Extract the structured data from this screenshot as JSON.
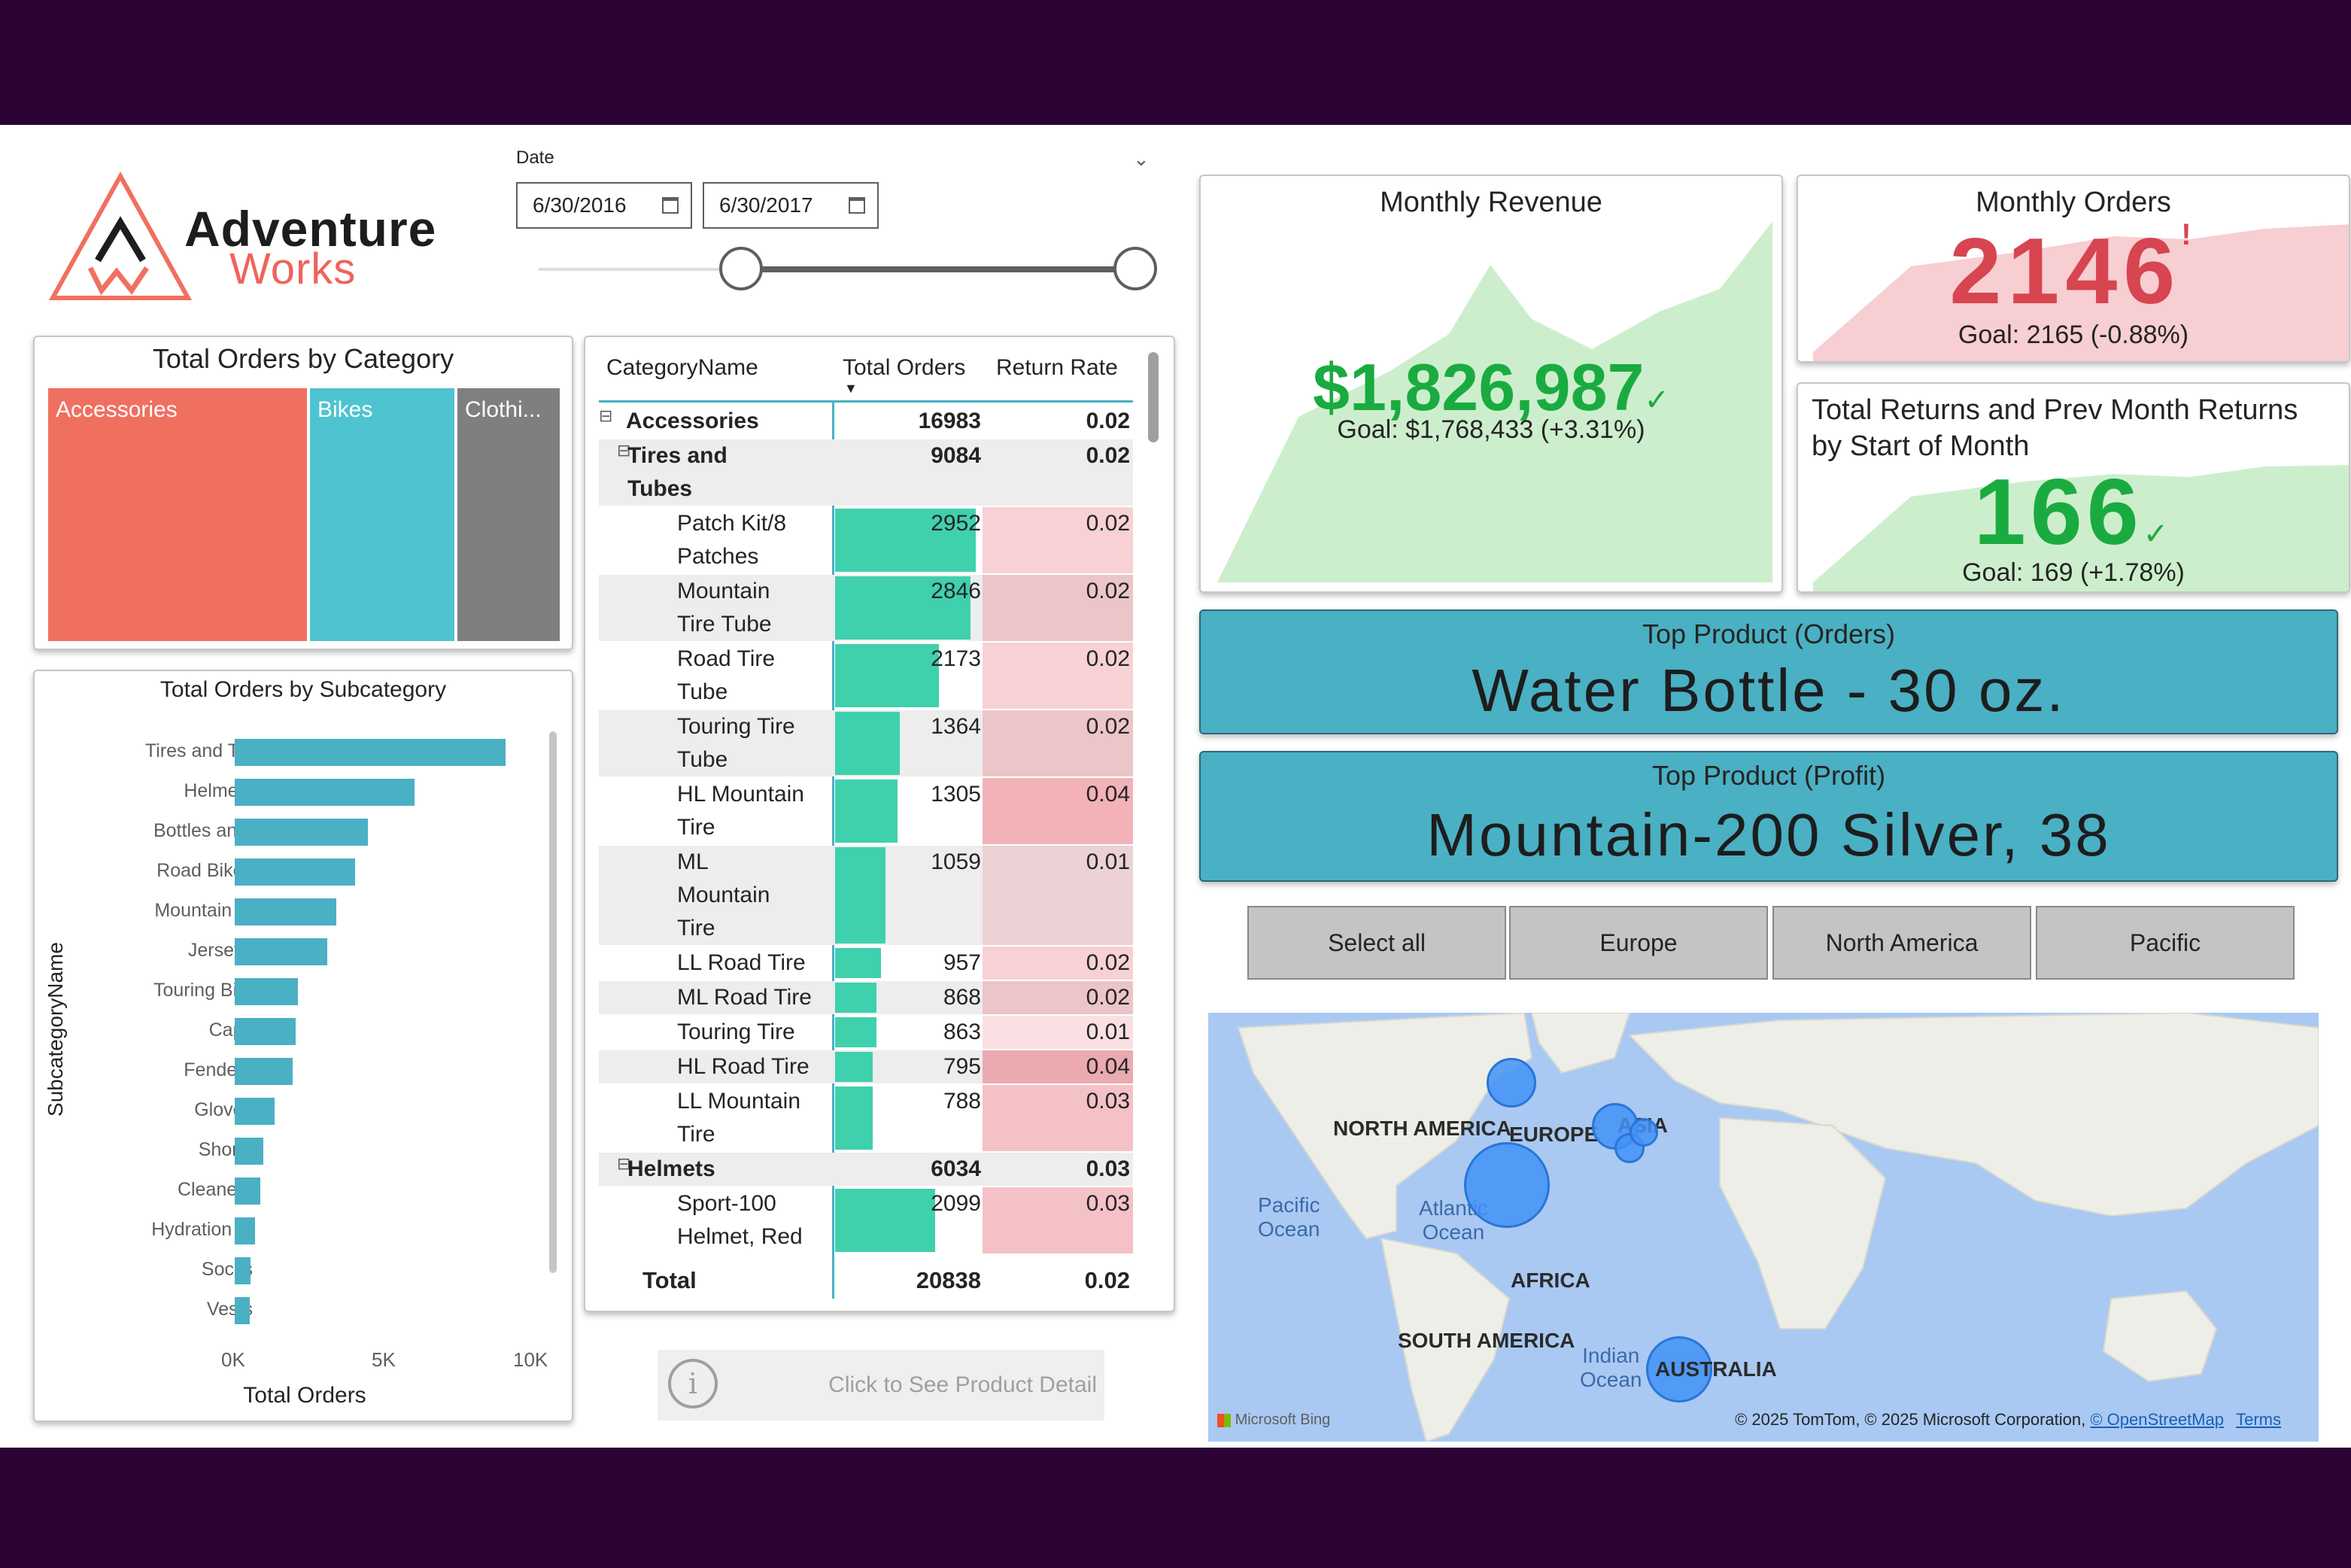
{
  "logo": {
    "brand_top": "Adventure",
    "brand_bottom": "Works"
  },
  "date_slicer": {
    "label": "Date",
    "start": "6/30/2016",
    "end": "6/30/2017"
  },
  "treemap": {
    "title": "Total Orders by Category",
    "cells": [
      {
        "label": "Accessories",
        "color": "#f0705f"
      },
      {
        "label": "Bikes",
        "color": "#4ec4d0"
      },
      {
        "label": "Clothi...",
        "color": "#7f7f7f"
      }
    ]
  },
  "subcategory_chart": {
    "title": "Total Orders by Subcategory",
    "ylabel": "SubcategoryName",
    "xlabel": "Total Orders",
    "ticks": [
      "0K",
      "5K",
      "10K"
    ]
  },
  "chart_data": {
    "type": "bar",
    "title": "Total Orders by Subcategory",
    "xlabel": "Total Orders",
    "ylabel": "SubcategoryName",
    "xlim": [
      0,
      10000
    ],
    "categories": [
      "Tires and T...",
      "Helmets",
      "Bottles an...",
      "Road Bikes",
      "Mountain ...",
      "Jerseys",
      "Touring Bi...",
      "Caps",
      "Fenders",
      "Gloves",
      "Shorts",
      "Cleaners",
      "Hydration ...",
      "Socks",
      "Vests"
    ],
    "values": [
      9084,
      6034,
      4470,
      4050,
      3420,
      3100,
      2120,
      2050,
      1950,
      1330,
      950,
      850,
      690,
      520,
      500
    ]
  },
  "matrix": {
    "headers": {
      "name": "CategoryName",
      "orders": "Total Orders",
      "return": "Return Rate"
    },
    "max_orders": 3000,
    "rows": [
      {
        "level": 0,
        "lines": [
          "Accessories"
        ],
        "orders": "16983",
        "rate": "0.02",
        "bold": true,
        "expander": "⊟"
      },
      {
        "level": 1,
        "lines": [
          "Tires and",
          "Tubes"
        ],
        "orders": "9084",
        "rate": "0.02",
        "bold": true,
        "expander": "⊟"
      },
      {
        "level": 2,
        "lines": [
          "Patch Kit/8",
          "Patches"
        ],
        "orders": "2952",
        "rate": "0.02",
        "n": 2952,
        "r": 0.02
      },
      {
        "level": 2,
        "lines": [
          "Mountain",
          "Tire Tube"
        ],
        "orders": "2846",
        "rate": "0.02",
        "n": 2846,
        "r": 0.02
      },
      {
        "level": 2,
        "lines": [
          "Road Tire",
          "Tube"
        ],
        "orders": "2173",
        "rate": "0.02",
        "n": 2173,
        "r": 0.02
      },
      {
        "level": 2,
        "lines": [
          "Touring Tire",
          "Tube"
        ],
        "orders": "1364",
        "rate": "0.02",
        "n": 1364,
        "r": 0.02
      },
      {
        "level": 2,
        "lines": [
          "HL Mountain",
          "Tire"
        ],
        "orders": "1305",
        "rate": "0.04",
        "n": 1305,
        "r": 0.04
      },
      {
        "level": 2,
        "lines": [
          "ML",
          "Mountain",
          "Tire"
        ],
        "orders": "1059",
        "rate": "0.01",
        "n": 1059,
        "r": 0.01
      },
      {
        "level": 2,
        "lines": [
          "LL Road Tire"
        ],
        "orders": "957",
        "rate": "0.02",
        "n": 957,
        "r": 0.02
      },
      {
        "level": 2,
        "lines": [
          "ML Road Tire"
        ],
        "orders": "868",
        "rate": "0.02",
        "n": 868,
        "r": 0.02
      },
      {
        "level": 2,
        "lines": [
          "Touring Tire"
        ],
        "orders": "863",
        "rate": "0.01",
        "n": 863,
        "r": 0.01
      },
      {
        "level": 2,
        "lines": [
          "HL Road Tire"
        ],
        "orders": "795",
        "rate": "0.04",
        "n": 795,
        "r": 0.04
      },
      {
        "level": 2,
        "lines": [
          "LL Mountain",
          "Tire"
        ],
        "orders": "788",
        "rate": "0.03",
        "n": 788,
        "r": 0.03
      },
      {
        "level": 1,
        "lines": [
          "Helmets"
        ],
        "orders": "6034",
        "rate": "0.03",
        "bold": true,
        "expander": "⊟"
      },
      {
        "level": 2,
        "lines": [
          "Sport-100",
          "Helmet, Red"
        ],
        "orders": "2099",
        "rate": "0.03",
        "n": 2099,
        "r": 0.03
      }
    ],
    "total": {
      "label": "Total",
      "orders": "20838",
      "rate": "0.02"
    }
  },
  "product_detail_button": {
    "label": "Click to See Product Detail"
  },
  "kpi_revenue": {
    "title": "Monthly Revenue",
    "value": "$1,826,987",
    "goal": "Goal: $1,768,433 (+3.31%)",
    "check": "✓"
  },
  "kpi_orders": {
    "title": "Monthly Orders",
    "value": "2146",
    "goal": "Goal: 2165 (-0.88%)",
    "alert": "!"
  },
  "kpi_returns": {
    "title_line1": "Total Returns and Prev Month Returns",
    "title_line2": "by Start of Month",
    "value": "166",
    "goal": "Goal: 169 (+1.78%)",
    "check": "✓"
  },
  "top_product_orders": {
    "title": "Top Product (Orders)",
    "value": "Water Bottle - 30 oz."
  },
  "top_product_profit": {
    "title": "Top Product (Profit)",
    "value": "Mountain-200 Silver, 38"
  },
  "region_buttons": [
    "Select all",
    "Europe",
    "North America",
    "Pacific"
  ],
  "map": {
    "labels": {
      "na": "NORTH AMERICA",
      "eu": "EUROPE",
      "asia": "ASIA",
      "africa": "AFRICA",
      "sa": "SOUTH AMERICA",
      "au": "AUSTRALIA"
    },
    "oceans": {
      "pacific_1": "Pacific",
      "pacific_2": "Ocean",
      "atlantic_1": "Atlantic",
      "atlantic_2": "Ocean",
      "indian_1": "Indian",
      "indian_2": "Ocean"
    },
    "attribution": "© 2025 TomTom, © 2025 Microsoft Corporation,",
    "osm": "© OpenStreetMap",
    "terms": "Terms",
    "bing": "Microsoft Bing"
  }
}
